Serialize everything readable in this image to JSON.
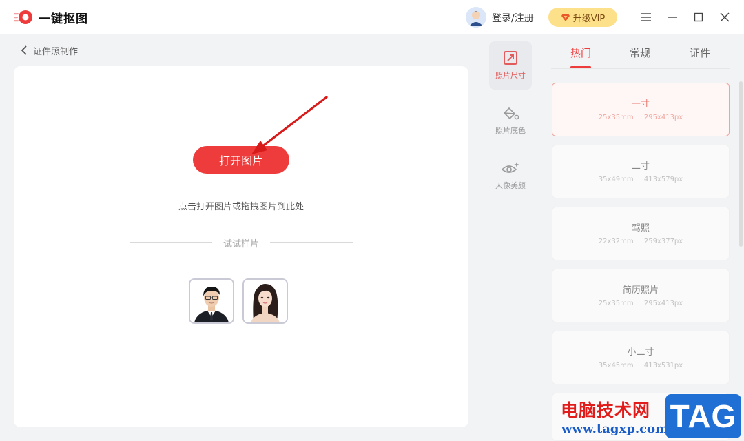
{
  "app": {
    "title": "一键抠图"
  },
  "header": {
    "login_label": "登录/注册",
    "vip_label": "升级VIP"
  },
  "page": {
    "back_label": "证件照制作"
  },
  "main": {
    "open_button_label": "打开图片",
    "hint": "点击打开图片或拖拽图片到此处",
    "try_samples_label": "试试样片"
  },
  "tools": [
    {
      "label": "照片尺寸",
      "icon": "resize-icon",
      "active": true
    },
    {
      "label": "照片底色",
      "icon": "paint-bucket-icon",
      "active": false
    },
    {
      "label": "人像美颜",
      "icon": "eye-sparkle-icon",
      "active": false
    }
  ],
  "tabs": [
    {
      "label": "热门",
      "active": true
    },
    {
      "label": "常规",
      "active": false
    },
    {
      "label": "证件",
      "active": false
    }
  ],
  "sizes": [
    {
      "name": "一寸",
      "mm": "25x35mm",
      "px": "295x413px",
      "selected": true
    },
    {
      "name": "二寸",
      "mm": "35x49mm",
      "px": "413x579px",
      "selected": false
    },
    {
      "name": "驾照",
      "mm": "22x32mm",
      "px": "259x377px",
      "selected": false
    },
    {
      "name": "简历照片",
      "mm": "25x35mm",
      "px": "295x413px",
      "selected": false
    },
    {
      "name": "小二寸",
      "mm": "35x45mm",
      "px": "413x531px",
      "selected": false
    }
  ],
  "watermark": {
    "text": "电脑技术网",
    "url": "www.tagxp.com",
    "tag": "TAG"
  },
  "colors": {
    "accent": "#ee3b3b",
    "vip_bg": "#fde08a",
    "watermark_red": "#e21b1b",
    "watermark_blue": "#1f6fd4"
  }
}
